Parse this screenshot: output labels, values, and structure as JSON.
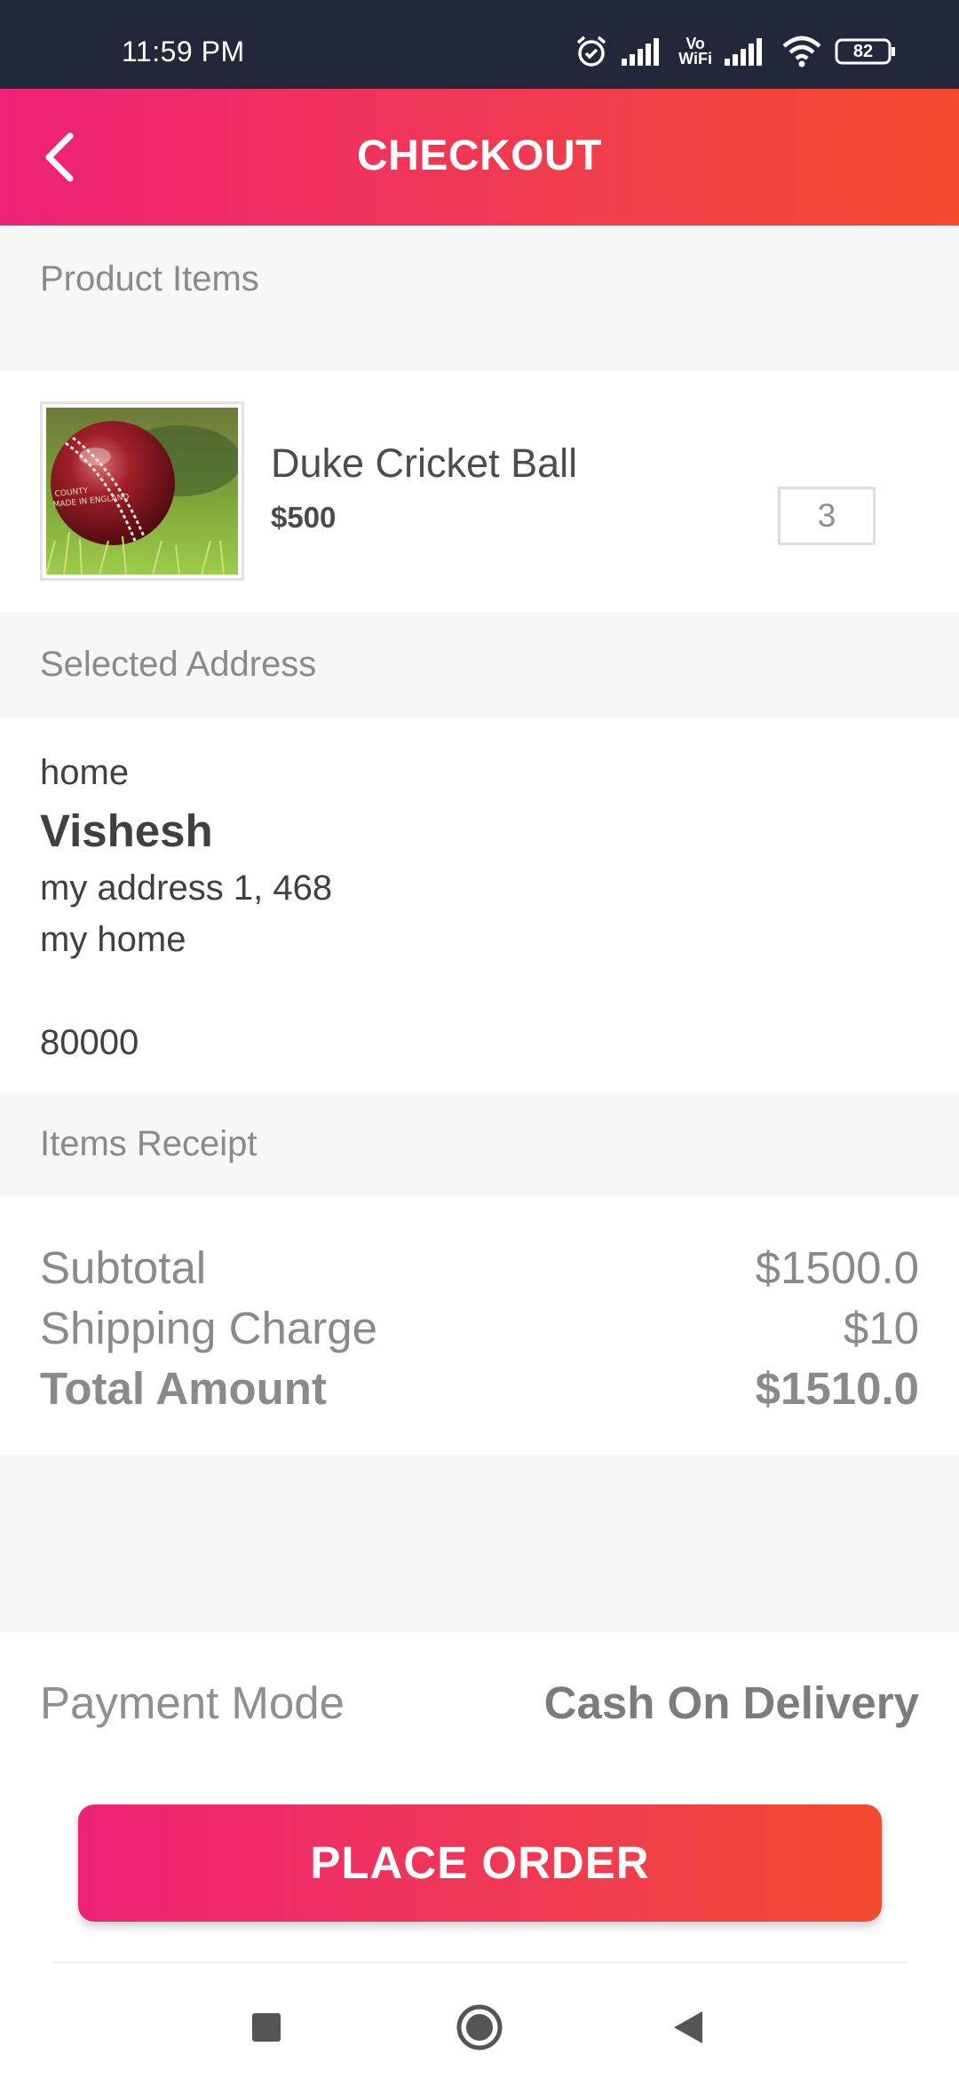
{
  "status_bar": {
    "time": "11:59 PM",
    "vowifi_top": "Vo",
    "vowifi_bottom": "WiFi",
    "battery": "82"
  },
  "header": {
    "title": "CHECKOUT"
  },
  "sections": {
    "product_items": "Product Items",
    "selected_address": "Selected Address",
    "items_receipt": "Items Receipt"
  },
  "product": {
    "name": "Duke Cricket Ball",
    "price": "$500",
    "quantity": "3",
    "image_text": "COUNTY MADE IN ENGLAND"
  },
  "address": {
    "type": "home",
    "name": "Vishesh",
    "line1": "my address 1, 468",
    "line2": "my home",
    "line3": "",
    "pincode": "80000"
  },
  "receipt": {
    "subtotal_label": "Subtotal",
    "subtotal_value": "$1500.0",
    "shipping_label": "Shipping Charge",
    "shipping_value": "$10",
    "total_label": "Total Amount",
    "total_value": "$1510.0"
  },
  "payment": {
    "label": "Payment Mode",
    "value": "Cash On Delivery"
  },
  "actions": {
    "place_order": "PLACE ORDER"
  },
  "theme": {
    "gradient_start": "#ee2276",
    "gradient_end": "#f44a2e",
    "status_bar_bg": "#22283a",
    "section_bg": "#f7f7f7"
  },
  "nav_icons": [
    "recents-square-icon",
    "home-circle-icon",
    "back-triangle-icon"
  ]
}
